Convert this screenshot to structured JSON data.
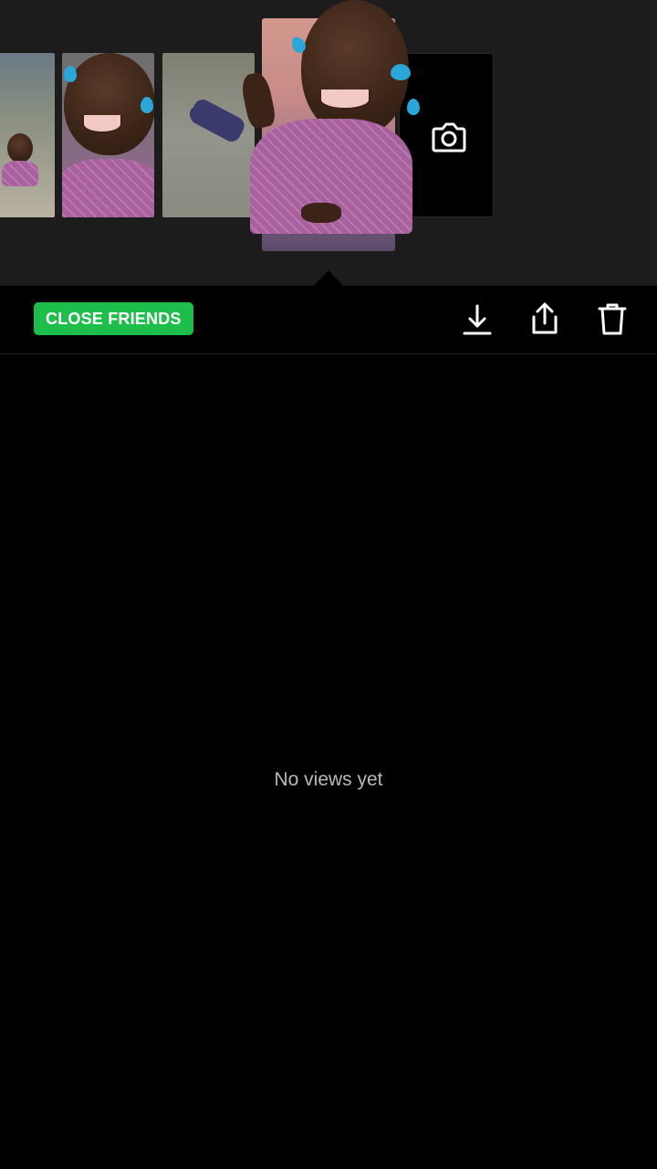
{
  "story_strip": {
    "thumbnails": [
      {
        "name": "story-thumb-1",
        "icon": "photo"
      },
      {
        "name": "story-thumb-2",
        "icon": "avatar-laughing"
      },
      {
        "name": "story-thumb-3",
        "icon": "photo"
      },
      {
        "name": "story-thumb-4-selected",
        "icon": "avatar-waving",
        "selected": true
      },
      {
        "name": "add-story-tile",
        "icon": "camera-icon"
      }
    ]
  },
  "action_bar": {
    "audience_label": "CLOSE FRIENDS",
    "audience_color": "#1dbf4a",
    "icons": [
      "download-icon",
      "share-icon",
      "trash-icon"
    ]
  },
  "viewers": {
    "empty_text": "No views yet"
  }
}
